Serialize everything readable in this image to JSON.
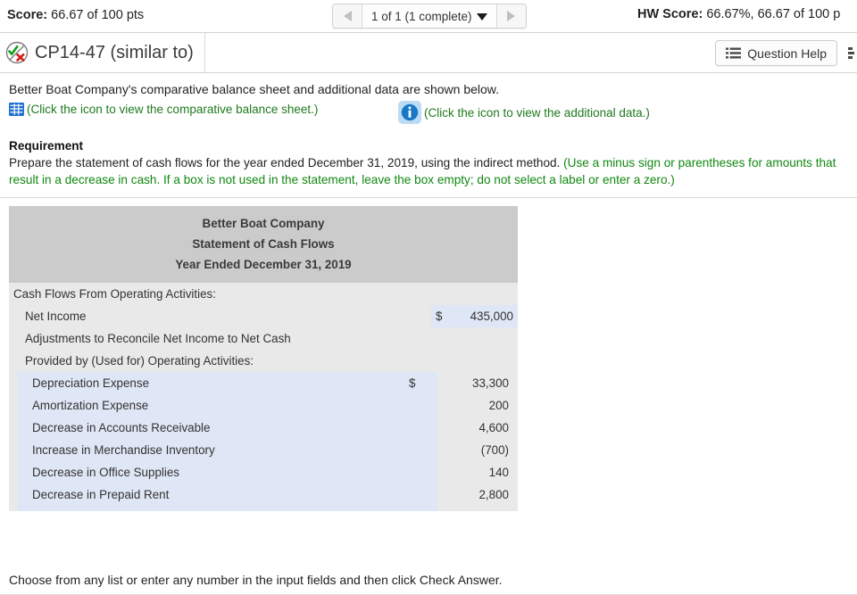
{
  "scorebar": {
    "score_label": "Score:",
    "score_value": "66.67 of 100 pts",
    "pager": {
      "prev_icon": "triangle-left-icon",
      "next_icon": "triangle-right-icon",
      "text": "1 of 1 (1 complete)",
      "caret_icon": "caret-down-icon"
    },
    "hw_label": "HW Score:",
    "hw_value": "66.67%, 66.67 of 100 p"
  },
  "question_bar": {
    "status_icon": "check-x-circle-icon",
    "title": "CP14-47 (similar to)",
    "help_button": {
      "icon": "list-icon",
      "label": "Question Help"
    },
    "edge_icon": "cut-off-icon"
  },
  "content": {
    "intro": "Better Boat Company's comparative balance sheet and additional data are shown below.",
    "links": [
      {
        "icon": "table-grid-icon",
        "text": "(Click the icon to view the comparative balance sheet.)"
      },
      {
        "icon": "info-circle-icon",
        "text": "(Click the icon to view the additional data.)"
      }
    ],
    "requirement_heading": "Requirement",
    "requirement_text": "Prepare the statement of cash flows for the year ended December 31, 2019, using the indirect method. ",
    "requirement_hint": "(Use a minus sign or parentheses for amounts that result in a decrease in cash. If a box is not used in the statement, leave the box empty; do not select a label or enter a zero.)"
  },
  "statement": {
    "header": {
      "company": "Better Boat Company",
      "title": "Statement of Cash Flows",
      "period": "Year Ended December 31, 2019"
    },
    "rows": [
      {
        "label": "Cash Flows From Operating Activities:",
        "indent": "lv0",
        "dollar": "",
        "amount": ""
      },
      {
        "label": "Net Income",
        "indent": "lv1",
        "dollar": "$",
        "amount": "435,000"
      },
      {
        "label": "Adjustments to Reconcile Net Income to Net Cash",
        "indent": "lv1",
        "dollar": "",
        "amount": ""
      },
      {
        "label": "Provided by (Used for) Operating Activities:",
        "indent": "lv1",
        "dollar": "",
        "amount": ""
      },
      {
        "label": "Depreciation Expense",
        "indent": "lv2",
        "dollar": "$",
        "amount": "33,300"
      },
      {
        "label": "Amortization Expense",
        "indent": "lv2",
        "dollar": "",
        "amount": "200"
      },
      {
        "label": "Decrease in Accounts Receivable",
        "indent": "lv2",
        "dollar": "",
        "amount": "4,600"
      },
      {
        "label": "Increase in Merchandise Inventory",
        "indent": "lv2",
        "dollar": "",
        "amount": "(700)"
      },
      {
        "label": "Decrease in Office Supplies",
        "indent": "lv2",
        "dollar": "",
        "amount": "140"
      },
      {
        "label": "Decrease in Prepaid Rent",
        "indent": "lv2",
        "dollar": "",
        "amount": "2,800"
      }
    ],
    "highlight_color": "#dfe6f5",
    "body_color": "#e9e9e9",
    "header_color": "#cbcbcb"
  },
  "footer": {
    "note": "Choose from any list or enter any number in the input fields and then click Check Answer."
  }
}
